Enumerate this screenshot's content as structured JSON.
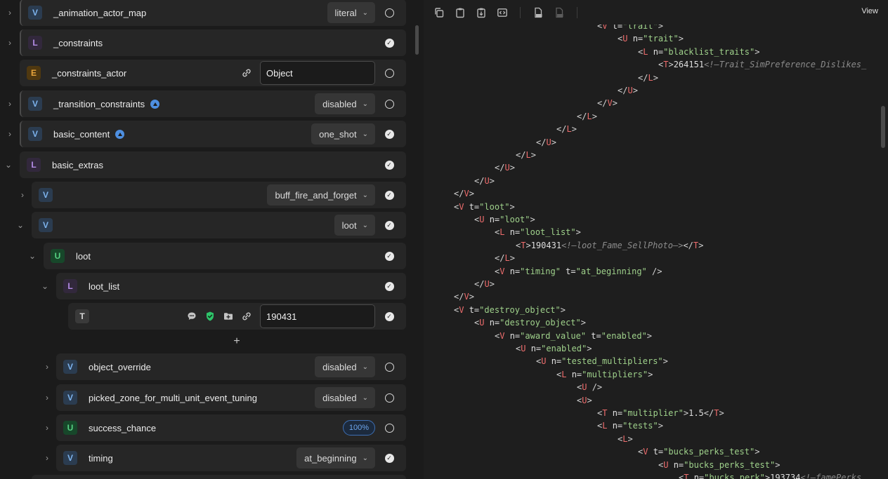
{
  "tree": {
    "rows": [
      {
        "badge": "V",
        "label": "_animation_actor_map",
        "dropdown": "literal",
        "status": "empty",
        "expander": "›"
      },
      {
        "badge": "L",
        "label": "_constraints",
        "status": "check",
        "expander": "›"
      },
      {
        "badge": "E",
        "label": "_constraints_actor",
        "input": "Object",
        "status": "empty"
      },
      {
        "badge": "V",
        "label": "_transition_constraints",
        "dropdown": "disabled",
        "status": "empty",
        "expander": "›"
      },
      {
        "badge": "V",
        "label": "basic_content",
        "dropdown": "one_shot",
        "status": "check",
        "expander": "›"
      },
      {
        "badge": "L",
        "label": "basic_extras",
        "status": "check",
        "expander": "⌄"
      },
      {
        "badge": "V",
        "label": "",
        "dropdown": "buff_fire_and_forget",
        "status": "check",
        "expander": "›"
      },
      {
        "badge": "V",
        "label": "",
        "dropdown": "loot",
        "status": "check",
        "expander": "⌄"
      },
      {
        "badge": "U",
        "label": "loot",
        "status": "check",
        "expander": "⌄"
      },
      {
        "badge": "L",
        "label": "loot_list",
        "status": "check",
        "expander": "⌄"
      },
      {
        "badge": "T",
        "label": "",
        "input": "190431",
        "status": "check"
      },
      {
        "badge": "V",
        "label": "object_override",
        "dropdown": "disabled",
        "status": "empty",
        "expander": "›"
      },
      {
        "badge": "V",
        "label": "picked_zone_for_multi_unit_event_tuning",
        "dropdown": "disabled",
        "status": "empty",
        "expander": "›"
      },
      {
        "badge": "U",
        "label": "success_chance",
        "pill": "100%",
        "status": "empty",
        "expander": "›"
      },
      {
        "badge": "V",
        "label": "timing",
        "dropdown": "at_beginning",
        "status": "check",
        "expander": "›"
      }
    ],
    "add_label": "+"
  },
  "toolbar": {
    "icons": [
      "copy-icon",
      "paste-icon",
      "paste-special-icon",
      "code-brackets-icon",
      "xml-file-icon",
      "xml-file-disabled-icon"
    ],
    "view_label": "View"
  },
  "code": {
    "lines": [
      [
        {
          "t": "b",
          "v": "<"
        },
        {
          "t": "t",
          "v": "V"
        },
        {
          "t": "a",
          "v": " t="
        },
        {
          "t": "v",
          "v": "\"trait\""
        },
        {
          "t": "b",
          "v": ">"
        }
      ],
      [
        {
          "t": "b",
          "v": "<"
        },
        {
          "t": "t",
          "v": "U"
        },
        {
          "t": "a",
          "v": " n="
        },
        {
          "t": "v",
          "v": "\"trait\""
        },
        {
          "t": "b",
          "v": ">"
        }
      ],
      [
        {
          "t": "b",
          "v": "<"
        },
        {
          "t": "t",
          "v": "L"
        },
        {
          "t": "a",
          "v": " n="
        },
        {
          "t": "v",
          "v": "\"blacklist_traits\""
        },
        {
          "t": "b",
          "v": ">"
        }
      ],
      [
        {
          "t": "b",
          "v": "<"
        },
        {
          "t": "t",
          "v": "T"
        },
        {
          "t": "b",
          "v": ">"
        },
        {
          "t": "x",
          "v": "264151"
        },
        {
          "t": "c",
          "v": "<!—Trait_SimPreference_Dislikes_"
        }
      ],
      [
        {
          "t": "b",
          "v": "</"
        },
        {
          "t": "t",
          "v": "L"
        },
        {
          "t": "b",
          "v": ">"
        }
      ],
      [
        {
          "t": "b",
          "v": "</"
        },
        {
          "t": "t",
          "v": "U"
        },
        {
          "t": "b",
          "v": ">"
        }
      ],
      [
        {
          "t": "b",
          "v": "</"
        },
        {
          "t": "t",
          "v": "V"
        },
        {
          "t": "b",
          "v": ">"
        }
      ],
      [
        {
          "t": "b",
          "v": "</"
        },
        {
          "t": "t",
          "v": "L"
        },
        {
          "t": "b",
          "v": ">"
        }
      ],
      [
        {
          "t": "b",
          "v": "</"
        },
        {
          "t": "t",
          "v": "L"
        },
        {
          "t": "b",
          "v": ">"
        }
      ],
      [
        {
          "t": "b",
          "v": "</"
        },
        {
          "t": "t",
          "v": "U"
        },
        {
          "t": "b",
          "v": ">"
        }
      ],
      [
        {
          "t": "b",
          "v": "</"
        },
        {
          "t": "t",
          "v": "L"
        },
        {
          "t": "b",
          "v": ">"
        }
      ],
      [
        {
          "t": "b",
          "v": "</"
        },
        {
          "t": "t",
          "v": "U"
        },
        {
          "t": "b",
          "v": ">"
        }
      ],
      [
        {
          "t": "b",
          "v": "</"
        },
        {
          "t": "t",
          "v": "U"
        },
        {
          "t": "b",
          "v": ">"
        }
      ],
      [
        {
          "t": "b",
          "v": "</"
        },
        {
          "t": "t",
          "v": "V"
        },
        {
          "t": "b",
          "v": ">"
        }
      ],
      [
        {
          "t": "b",
          "v": "<"
        },
        {
          "t": "t",
          "v": "V"
        },
        {
          "t": "a",
          "v": " t="
        },
        {
          "t": "v",
          "v": "\"loot\""
        },
        {
          "t": "b",
          "v": ">"
        }
      ],
      [
        {
          "t": "b",
          "v": "<"
        },
        {
          "t": "t",
          "v": "U"
        },
        {
          "t": "a",
          "v": " n="
        },
        {
          "t": "v",
          "v": "\"loot\""
        },
        {
          "t": "b",
          "v": ">"
        }
      ],
      [
        {
          "t": "b",
          "v": "<"
        },
        {
          "t": "t",
          "v": "L"
        },
        {
          "t": "a",
          "v": " n="
        },
        {
          "t": "v",
          "v": "\"loot_list\""
        },
        {
          "t": "b",
          "v": ">"
        }
      ],
      [
        {
          "t": "b",
          "v": "<"
        },
        {
          "t": "t",
          "v": "T"
        },
        {
          "t": "b",
          "v": ">"
        },
        {
          "t": "x",
          "v": "190431"
        },
        {
          "t": "c",
          "v": "<!—loot_Fame_SellPhoto—>"
        },
        {
          "t": "b",
          "v": "</"
        },
        {
          "t": "t",
          "v": "T"
        },
        {
          "t": "b",
          "v": ">"
        }
      ],
      [
        {
          "t": "b",
          "v": "</"
        },
        {
          "t": "t",
          "v": "L"
        },
        {
          "t": "b",
          "v": ">"
        }
      ],
      [
        {
          "t": "b",
          "v": "<"
        },
        {
          "t": "t",
          "v": "V"
        },
        {
          "t": "a",
          "v": " n="
        },
        {
          "t": "v",
          "v": "\"timing\""
        },
        {
          "t": "a",
          "v": " t="
        },
        {
          "t": "v",
          "v": "\"at_beginning\""
        },
        {
          "t": "b",
          "v": " />"
        }
      ],
      [
        {
          "t": "b",
          "v": "</"
        },
        {
          "t": "t",
          "v": "U"
        },
        {
          "t": "b",
          "v": ">"
        }
      ],
      [
        {
          "t": "b",
          "v": "</"
        },
        {
          "t": "t",
          "v": "V"
        },
        {
          "t": "b",
          "v": ">"
        }
      ],
      [
        {
          "t": "b",
          "v": "<"
        },
        {
          "t": "t",
          "v": "V"
        },
        {
          "t": "a",
          "v": " t="
        },
        {
          "t": "v",
          "v": "\"destroy_object\""
        },
        {
          "t": "b",
          "v": ">"
        }
      ],
      [
        {
          "t": "b",
          "v": "<"
        },
        {
          "t": "t",
          "v": "U"
        },
        {
          "t": "a",
          "v": " n="
        },
        {
          "t": "v",
          "v": "\"destroy_object\""
        },
        {
          "t": "b",
          "v": ">"
        }
      ],
      [
        {
          "t": "b",
          "v": "<"
        },
        {
          "t": "t",
          "v": "V"
        },
        {
          "t": "a",
          "v": " n="
        },
        {
          "t": "v",
          "v": "\"award_value\""
        },
        {
          "t": "a",
          "v": " t="
        },
        {
          "t": "v",
          "v": "\"enabled\""
        },
        {
          "t": "b",
          "v": ">"
        }
      ],
      [
        {
          "t": "b",
          "v": "<"
        },
        {
          "t": "t",
          "v": "U"
        },
        {
          "t": "a",
          "v": " n="
        },
        {
          "t": "v",
          "v": "\"enabled\""
        },
        {
          "t": "b",
          "v": ">"
        }
      ],
      [
        {
          "t": "b",
          "v": "<"
        },
        {
          "t": "t",
          "v": "U"
        },
        {
          "t": "a",
          "v": " n="
        },
        {
          "t": "v",
          "v": "\"tested_multipliers\""
        },
        {
          "t": "b",
          "v": ">"
        }
      ],
      [
        {
          "t": "b",
          "v": "<"
        },
        {
          "t": "t",
          "v": "L"
        },
        {
          "t": "a",
          "v": " n="
        },
        {
          "t": "v",
          "v": "\"multipliers\""
        },
        {
          "t": "b",
          "v": ">"
        }
      ],
      [
        {
          "t": "b",
          "v": "<"
        },
        {
          "t": "t",
          "v": "U"
        },
        {
          "t": "b",
          "v": " />"
        }
      ],
      [
        {
          "t": "b",
          "v": "<"
        },
        {
          "t": "t",
          "v": "U"
        },
        {
          "t": "b",
          "v": ">"
        }
      ],
      [
        {
          "t": "b",
          "v": "<"
        },
        {
          "t": "t",
          "v": "T"
        },
        {
          "t": "a",
          "v": " n="
        },
        {
          "t": "v",
          "v": "\"multiplier\""
        },
        {
          "t": "b",
          "v": ">"
        },
        {
          "t": "x",
          "v": "1.5"
        },
        {
          "t": "b",
          "v": "</"
        },
        {
          "t": "t",
          "v": "T"
        },
        {
          "t": "b",
          "v": ">"
        }
      ],
      [
        {
          "t": "b",
          "v": "<"
        },
        {
          "t": "t",
          "v": "L"
        },
        {
          "t": "a",
          "v": " n="
        },
        {
          "t": "v",
          "v": "\"tests\""
        },
        {
          "t": "b",
          "v": ">"
        }
      ],
      [
        {
          "t": "b",
          "v": "<"
        },
        {
          "t": "t",
          "v": "L"
        },
        {
          "t": "b",
          "v": ">"
        }
      ],
      [
        {
          "t": "b",
          "v": "<"
        },
        {
          "t": "t",
          "v": "V"
        },
        {
          "t": "a",
          "v": " t="
        },
        {
          "t": "v",
          "v": "\"bucks_perks_test\""
        },
        {
          "t": "b",
          "v": ">"
        }
      ],
      [
        {
          "t": "b",
          "v": "<"
        },
        {
          "t": "t",
          "v": "U"
        },
        {
          "t": "a",
          "v": " n="
        },
        {
          "t": "v",
          "v": "\"bucks_perks_test\""
        },
        {
          "t": "b",
          "v": ">"
        }
      ],
      [
        {
          "t": "b",
          "v": "<"
        },
        {
          "t": "t",
          "v": "T"
        },
        {
          "t": "a",
          "v": " n="
        },
        {
          "t": "v",
          "v": "\"bucks_perk\""
        },
        {
          "t": "b",
          "v": ">"
        },
        {
          "t": "x",
          "v": "193734"
        },
        {
          "t": "c",
          "v": "<!—famePerks_"
        }
      ]
    ]
  }
}
